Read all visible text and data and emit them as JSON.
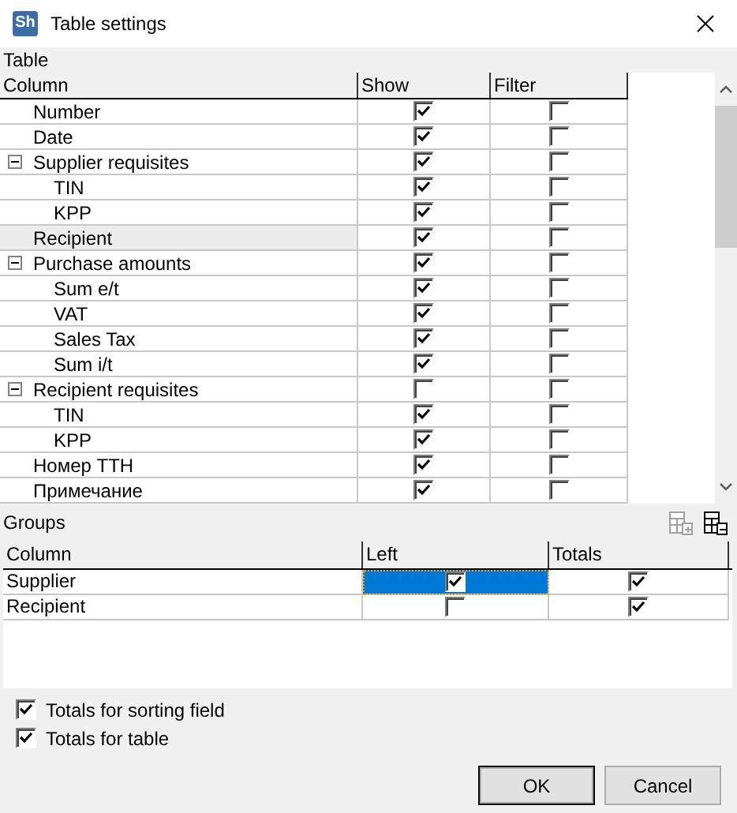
{
  "window": {
    "title": "Table settings",
    "logo": "Sh"
  },
  "table": {
    "label": "Table",
    "columns": [
      "Column",
      "Show",
      "Filter"
    ],
    "rows": [
      {
        "name": "Number",
        "show": true,
        "filter": false,
        "selected": false
      },
      {
        "name": "Date",
        "show": true,
        "filter": false,
        "selected": false
      },
      {
        "name": "Supplier requisites",
        "expanded": true,
        "show": true,
        "filter": false,
        "selected": false,
        "children": [
          {
            "name": "TIN",
            "show": true,
            "filter": false,
            "selected": false
          },
          {
            "name": "KPP",
            "show": true,
            "filter": false,
            "selected": false
          }
        ]
      },
      {
        "name": "Recipient",
        "show": true,
        "filter": false,
        "selected": true
      },
      {
        "name": "Purchase amounts",
        "expanded": true,
        "show": true,
        "filter": false,
        "selected": false,
        "children": [
          {
            "name": "Sum e/t",
            "show": true,
            "filter": false,
            "selected": false
          },
          {
            "name": "VAT",
            "show": true,
            "filter": false,
            "selected": false
          },
          {
            "name": "Sales Tax",
            "show": true,
            "filter": false,
            "selected": false
          },
          {
            "name": "Sum i/t",
            "show": true,
            "filter": false,
            "selected": false
          }
        ]
      },
      {
        "name": "Recipient requisites",
        "expanded": true,
        "show": false,
        "filter": false,
        "selected": false,
        "children": [
          {
            "name": "TIN",
            "show": true,
            "filter": false,
            "selected": false
          },
          {
            "name": "KPP",
            "show": true,
            "filter": false,
            "selected": false
          }
        ]
      },
      {
        "name": "Номер ТТН",
        "show": true,
        "filter": false,
        "selected": false
      },
      {
        "name": "Примечание",
        "show": true,
        "filter": false,
        "selected": false
      }
    ]
  },
  "groups": {
    "label": "Groups",
    "tools": [
      {
        "kind": "add",
        "disabled": true
      },
      {
        "kind": "remove",
        "disabled": false
      }
    ],
    "columns": [
      "Column",
      "Left",
      "Totals"
    ],
    "rows": [
      {
        "name": "Supplier",
        "left": true,
        "totals": true,
        "selected": true
      },
      {
        "name": "Recipient",
        "left": false,
        "totals": true,
        "selected": false
      }
    ]
  },
  "options": [
    {
      "label": "Totals for sorting field",
      "checked": true
    },
    {
      "label": "Totals for table",
      "checked": true
    }
  ],
  "buttons": [
    "OK",
    "Cancel"
  ]
}
